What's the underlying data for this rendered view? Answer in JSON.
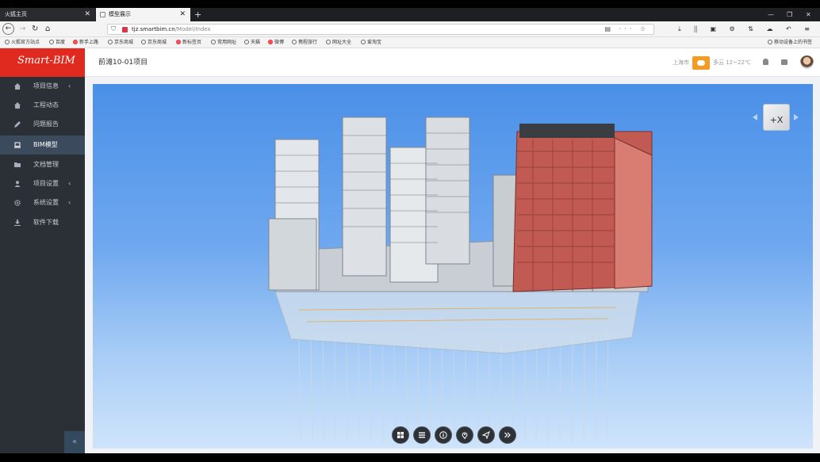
{
  "browser": {
    "tabs": [
      {
        "label": "火狐主页",
        "active": false
      },
      {
        "label": "模型展示",
        "active": true
      }
    ],
    "url_host": "tjz.smartbim.cn",
    "url_path": "/Model/Index",
    "bookmarks": [
      "火狐官方站点",
      "百度",
      "新手上路",
      "京东商城",
      "京东商城",
      "新标签页",
      "常用网址",
      "天猫",
      "微博",
      "携程旅行",
      "网址大全",
      "爱淘宝"
    ],
    "mobile_bookmarks": "移动设备上的书签"
  },
  "app": {
    "logo": "Smart-BIM",
    "project_title": "前滩10-01项目",
    "city": "上海市",
    "weather_text": "多云 12~22℃",
    "menu": [
      {
        "label": "项目信息",
        "icon": "home-icon",
        "has_children": true,
        "active": false
      },
      {
        "label": "工程动态",
        "icon": "home-icon",
        "has_children": false,
        "active": false
      },
      {
        "label": "问题报告",
        "icon": "pencil-icon",
        "has_children": false,
        "active": false
      },
      {
        "label": "BIM模型",
        "icon": "laptop-icon",
        "has_children": false,
        "active": true
      },
      {
        "label": "文档管理",
        "icon": "folder-icon",
        "has_children": false,
        "active": false
      },
      {
        "label": "项目设置",
        "icon": "user-icon",
        "has_children": true,
        "active": false
      },
      {
        "label": "系统设置",
        "icon": "gear-icon",
        "has_children": true,
        "active": false
      },
      {
        "label": "软件下载",
        "icon": "download-icon",
        "has_children": false,
        "active": false
      }
    ],
    "collapse_glyph": "«",
    "viewcube_label": "+X",
    "colors": {
      "sidebar": "#2b3036",
      "logo_bg": "#e02a20",
      "active_menu": "#3c4a5e",
      "weather": "#f59a23"
    }
  }
}
